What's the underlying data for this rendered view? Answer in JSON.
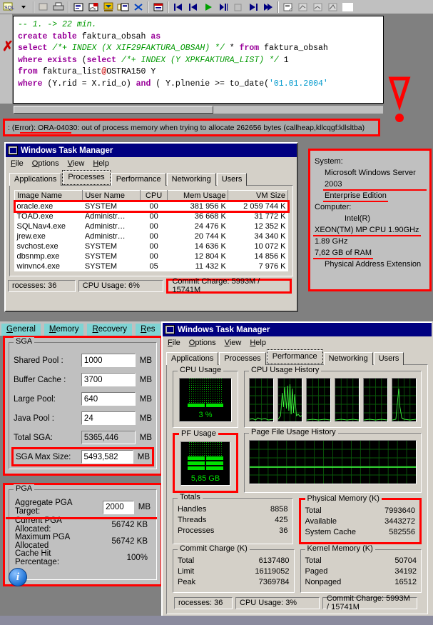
{
  "toolbar": {
    "icons": [
      "sql-icon",
      "dropdown-arrow-icon",
      "stop-icon",
      "print-icon",
      "script-icon",
      "explain-plan-icon",
      "import-icon",
      "describe-icon",
      "cancel-icon",
      "grid-icon",
      "first-record-icon",
      "prev-record-icon",
      "play-icon",
      "next-record-icon",
      "stop-record-icon",
      "last-record-icon",
      "end-record-icon",
      "report-icon",
      "chart-icon",
      "chart2-icon",
      "chart3-icon"
    ]
  },
  "sql_editor": {
    "marker": "✗",
    "lines": [
      {
        "parts": [
          {
            "t": "-- 1. -> 22 min.",
            "c": "cm"
          }
        ]
      },
      {
        "parts": [
          {
            "t": "create table ",
            "c": "k"
          },
          {
            "t": "faktura_obsah ",
            "c": "n"
          },
          {
            "t": "as",
            "c": "k"
          }
        ]
      },
      {
        "parts": [
          {
            "t": "select ",
            "c": "k"
          },
          {
            "t": "/*+ INDEX (X XIF29FAKTURA_OBSAH) */ ",
            "c": "cm"
          },
          {
            "t": "* ",
            "c": "n"
          },
          {
            "t": "from ",
            "c": "k"
          },
          {
            "t": "faktura_obsah",
            "c": "n"
          }
        ]
      },
      {
        "parts": [
          {
            "t": "where exists ",
            "c": "k"
          },
          {
            "t": "(",
            "c": "n"
          },
          {
            "t": "select ",
            "c": "k"
          },
          {
            "t": "/*+ INDEX (Y XPKFAKTURA_LIST) */ ",
            "c": "cm"
          },
          {
            "t": "1",
            "c": "n"
          }
        ]
      },
      {
        "parts": [
          {
            "t": "from ",
            "c": "k"
          },
          {
            "t": "faktura_list",
            "c": "n"
          },
          {
            "t": "@",
            "c": "at"
          },
          {
            "t": "OSTRA150 Y",
            "c": "n"
          }
        ]
      },
      {
        "parts": [
          {
            "t": "where ",
            "c": "k"
          },
          {
            "t": "(Y.rid = X.rid_o) ",
            "c": "n"
          },
          {
            "t": "and ",
            "c": "k"
          },
          {
            "t": "( Y.plnenie >= to_date(",
            "c": "n"
          },
          {
            "t": "'01.01.2004'",
            "c": "s"
          }
        ]
      }
    ]
  },
  "error_bar": {
    "text": ": (Error): ORA-04030: out of process memory when trying to allocate 262656 bytes (callheap,kllcqgf:kllsltba)"
  },
  "task_manager_processes": {
    "title": "Windows Task Manager",
    "menu": [
      "File",
      "Options",
      "View",
      "Help"
    ],
    "tabs": [
      "Applications",
      "Processes",
      "Performance",
      "Networking",
      "Users"
    ],
    "active_tab": "Processes",
    "columns": [
      "Image Name",
      "User Name",
      "CPU",
      "Mem Usage",
      "VM Size"
    ],
    "rows": [
      {
        "image": "oracle.exe",
        "user": "SYSTEM",
        "cpu": "00",
        "mem": "381 956 K",
        "vm": "2 059 744 K",
        "highlight": true
      },
      {
        "image": "TOAD.exe",
        "user": "Administr…",
        "cpu": "00",
        "mem": "36 668 K",
        "vm": "31 772 K",
        "highlight": false
      },
      {
        "image": "SQLNav4.exe",
        "user": "Administr…",
        "cpu": "00",
        "mem": "24 476 K",
        "vm": "12 352 K",
        "highlight": false
      },
      {
        "image": "jrew.exe",
        "user": "Administr…",
        "cpu": "00",
        "mem": "20 744 K",
        "vm": "34 340 K",
        "highlight": false
      },
      {
        "image": "svchost.exe",
        "user": "SYSTEM",
        "cpu": "00",
        "mem": "14 636 K",
        "vm": "10 072 K",
        "highlight": false
      },
      {
        "image": "dbsnmp.exe",
        "user": "SYSTEM",
        "cpu": "00",
        "mem": "12 804 K",
        "vm": "14 856 K",
        "highlight": false
      },
      {
        "image": "winvnc4.exe",
        "user": "SYSTEM",
        "cpu": "05",
        "mem": "11 432 K",
        "vm": "7 976 K",
        "highlight": false
      }
    ],
    "status": {
      "processes": "rocesses: 36",
      "cpu_usage": "CPU Usage: 6%",
      "commit_charge": "Commit Charge: 5993M / 15741M"
    }
  },
  "system_info": {
    "system_label": "System:",
    "os": "Microsoft Windows Server 2003",
    "edition": "Enterprise Edition",
    "computer_label": "Computer:",
    "vendor": "Intel(R)",
    "cpu": "XEON(TM) MP CPU 1.90GHz",
    "clock": "1.89 GHz",
    "ram": "7,62 GB of RAM",
    "pae": "Physical Address Extension"
  },
  "oracle_dialog": {
    "tabs": [
      "General",
      "Memory",
      "Recovery",
      "Res"
    ],
    "active_tab": "Memory",
    "sga": {
      "group_label": "SGA",
      "unit": "MB",
      "fields": [
        {
          "label": "Shared Pool :",
          "value": "1000",
          "readonly": false,
          "highlight": false
        },
        {
          "label": "Buffer Cache :",
          "value": "3700",
          "readonly": false,
          "highlight": false
        },
        {
          "label": "Large Pool:",
          "value": "640",
          "readonly": false,
          "highlight": false
        },
        {
          "label": "Java Pool :",
          "value": "24",
          "readonly": false,
          "highlight": false
        },
        {
          "label": "Total SGA:",
          "value": "5365,446",
          "readonly": true,
          "highlight": false
        },
        {
          "label": "SGA Max Size:",
          "value": "5493,582",
          "readonly": false,
          "highlight": true
        }
      ]
    },
    "pga": {
      "group_label": "PGA",
      "unit": "MB",
      "target_label": "Aggregate PGA Target:",
      "target_value": "2000",
      "rows": [
        {
          "label": "Current PGA Allocated:",
          "value": "56742 KB"
        },
        {
          "label": "Maximum PGA Allocated",
          "value": "56742 KB"
        },
        {
          "label": "Cache Hit Percentage:",
          "value": "100%"
        }
      ],
      "info_icon": "i"
    }
  },
  "task_manager_performance": {
    "title": "Windows Task Manager",
    "menu": [
      "File",
      "Options",
      "View",
      "Help"
    ],
    "tabs": [
      "Applications",
      "Processes",
      "Performance",
      "Networking",
      "Users"
    ],
    "active_tab": "Performance",
    "cpu_usage": {
      "label": "CPU Usage",
      "value": "3 %"
    },
    "cpu_history_label": "CPU Usage History",
    "pf_usage": {
      "label": "PF Usage",
      "value": "5,85 GB"
    },
    "pf_history_label": "Page File Usage History",
    "totals": {
      "label": "Totals",
      "rows": [
        {
          "label": "Handles",
          "value": "8858"
        },
        {
          "label": "Threads",
          "value": "425"
        },
        {
          "label": "Processes",
          "value": "36"
        }
      ]
    },
    "physical_memory": {
      "label": "Physical Memory (K)",
      "rows": [
        {
          "label": "Total",
          "value": "7993640"
        },
        {
          "label": "Available",
          "value": "3443272"
        },
        {
          "label": "System Cache",
          "value": "582556"
        }
      ]
    },
    "commit_charge": {
      "label": "Commit Charge (K)",
      "rows": [
        {
          "label": "Total",
          "value": "6137480"
        },
        {
          "label": "Limit",
          "value": "16119052"
        },
        {
          "label": "Peak",
          "value": "7369784"
        }
      ]
    },
    "kernel_memory": {
      "label": "Kernel Memory (K)",
      "rows": [
        {
          "label": "Total",
          "value": "50704"
        },
        {
          "label": "Paged",
          "value": "34192"
        },
        {
          "label": "Nonpaged",
          "value": "16512"
        }
      ]
    },
    "status": {
      "processes": "rocesses: 36",
      "cpu_usage": "CPU Usage: 3%",
      "commit_charge": "Commit Charge: 5993M / 15741M"
    }
  },
  "colors": {
    "annotation_red": "#ff0000",
    "titlebar_blue": "#000080",
    "graph_green": "#00e000",
    "tab_teal": "#7fd4d4"
  }
}
